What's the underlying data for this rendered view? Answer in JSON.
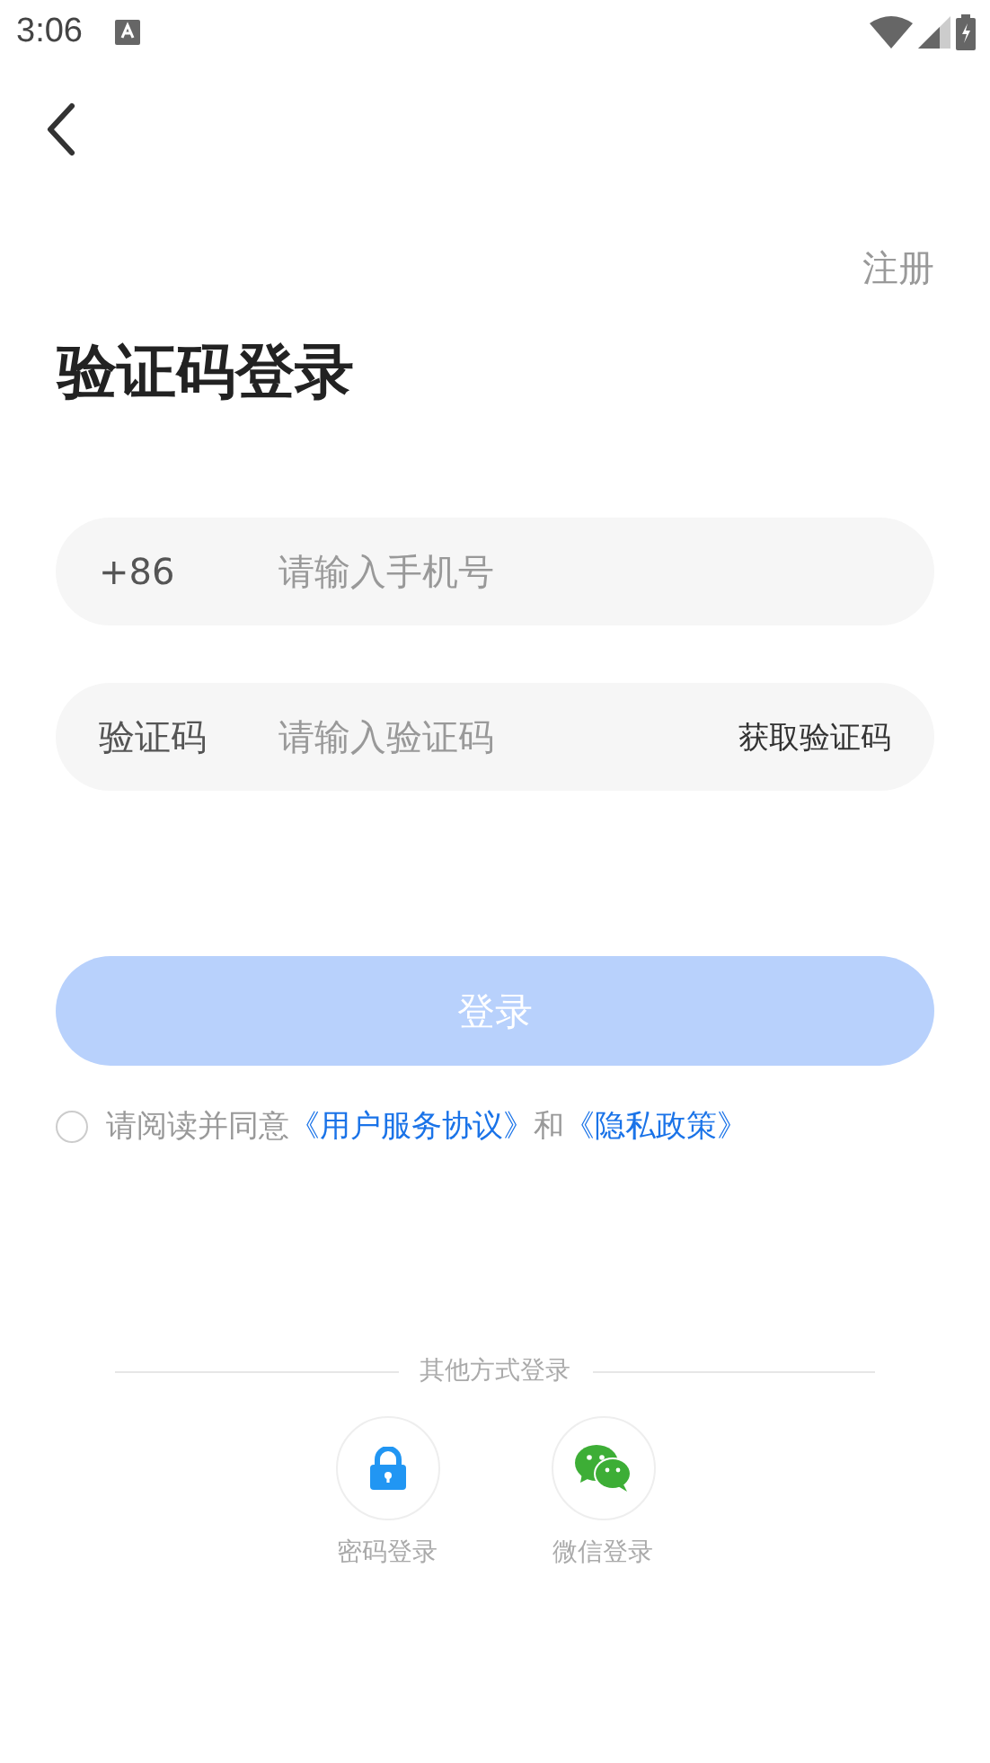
{
  "status_bar": {
    "time": "3:06"
  },
  "register_link": "注册",
  "title": "验证码登录",
  "phone_field": {
    "prefix": "+86",
    "placeholder": "请输入手机号"
  },
  "code_field": {
    "label": "验证码",
    "placeholder": "请输入验证码",
    "action": "获取验证码"
  },
  "login_button": {
    "label": "登录",
    "disabled": true
  },
  "agreement": {
    "checked": false,
    "parts": [
      {
        "kind": "text",
        "text": "请阅读并同意"
      },
      {
        "kind": "link",
        "text": "《用户服务协议》"
      },
      {
        "kind": "text",
        "text": "和"
      },
      {
        "kind": "link",
        "text": "《隐私政策》"
      }
    ]
  },
  "other_login": {
    "title": "其他方式登录",
    "options": [
      {
        "kind": "password",
        "label": "密码登录"
      },
      {
        "kind": "wechat",
        "label": "微信登录"
      }
    ]
  }
}
